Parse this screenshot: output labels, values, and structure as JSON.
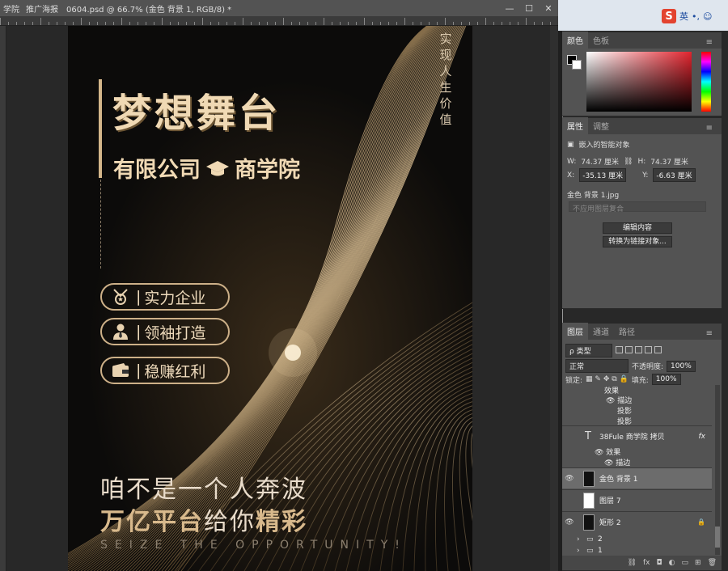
{
  "doc": {
    "crumb1": "学院",
    "crumb2": "推广海报",
    "tab_title": "0604.psd @ 66.7% (金色 背景 1, RGB/8) *",
    "win_min": "—",
    "win_max": "☐",
    "win_close": "✕"
  },
  "ruler": {
    "top_numbers": ""
  },
  "poster": {
    "vertical_text": "实现人生价值",
    "title": "梦想舞台",
    "subtitle_left": "有限公司",
    "subtitle_right": "商学院",
    "pills": [
      {
        "label": "实力企业",
        "icon": "medal-icon"
      },
      {
        "label": "领袖打造",
        "icon": "leader-icon"
      },
      {
        "label": "稳赚红利",
        "icon": "wallet-icon"
      }
    ],
    "pill_sep": "|",
    "slogan1": "咱不是一个人奔波",
    "slogan2_a": "万亿平台",
    "slogan2_b": "给你",
    "slogan2_c": "精彩",
    "english": "SEIZE THE OPPORTUNITY!"
  },
  "taskbar": {
    "ime_label": "英",
    "ime_extra": "•,",
    "smile": "☺",
    "mic": "🎤"
  },
  "color_panel": {
    "tab_color": "颜色",
    "tab_swatch": "色板",
    "menu": "≡"
  },
  "properties": {
    "tab_props": "属性",
    "tab_adjust": "调整",
    "menu": "≡",
    "type_label": "嵌入的智能对象",
    "w_label": "W:",
    "w_value": "74.37 厘米",
    "h_label": "H:",
    "h_value": "74.37 厘米",
    "x_label": "X:",
    "x_value": "-35.13 厘米",
    "y_label": "Y:",
    "y_value": "-6.63 厘米",
    "file_name": "金色 背景 1.jpg",
    "comp_placeholder": "不应用图层复合",
    "btn_edit": "编辑内容",
    "btn_convert": "转换为链接对象..."
  },
  "layers": {
    "tab_layers": "图层",
    "tab_channels": "通道",
    "tab_paths": "路径",
    "menu": "≡",
    "filter_kind": "ρ 类型",
    "blend_mode": "正常",
    "opacity_label": "不透明度:",
    "opacity_value": "100%",
    "lock_label": "锁定:",
    "fill_label": "填充:",
    "fill_value": "100%",
    "rows": [
      {
        "name": "效果",
        "kind": "sub"
      },
      {
        "name": "描边",
        "kind": "sub"
      },
      {
        "name": "投影",
        "kind": "sub"
      },
      {
        "name": "投影",
        "kind": "sub"
      },
      {
        "name": "38Fule       商学院 拷贝",
        "kind": "text"
      },
      {
        "name": "效果",
        "kind": "sub"
      },
      {
        "name": "描边",
        "kind": "sub"
      },
      {
        "name": "金色 背景 1",
        "kind": "selected"
      },
      {
        "name": "图层 7",
        "kind": "layer"
      },
      {
        "name": "矩形 2",
        "kind": "layer"
      },
      {
        "name": "2",
        "kind": "group"
      },
      {
        "name": "1",
        "kind": "group"
      }
    ],
    "fx": "fx",
    "bottom_icons": [
      "link-icon",
      "fx-icon",
      "mask-icon",
      "adjustment-icon",
      "group-icon",
      "new-layer-icon",
      "trash-icon"
    ]
  }
}
